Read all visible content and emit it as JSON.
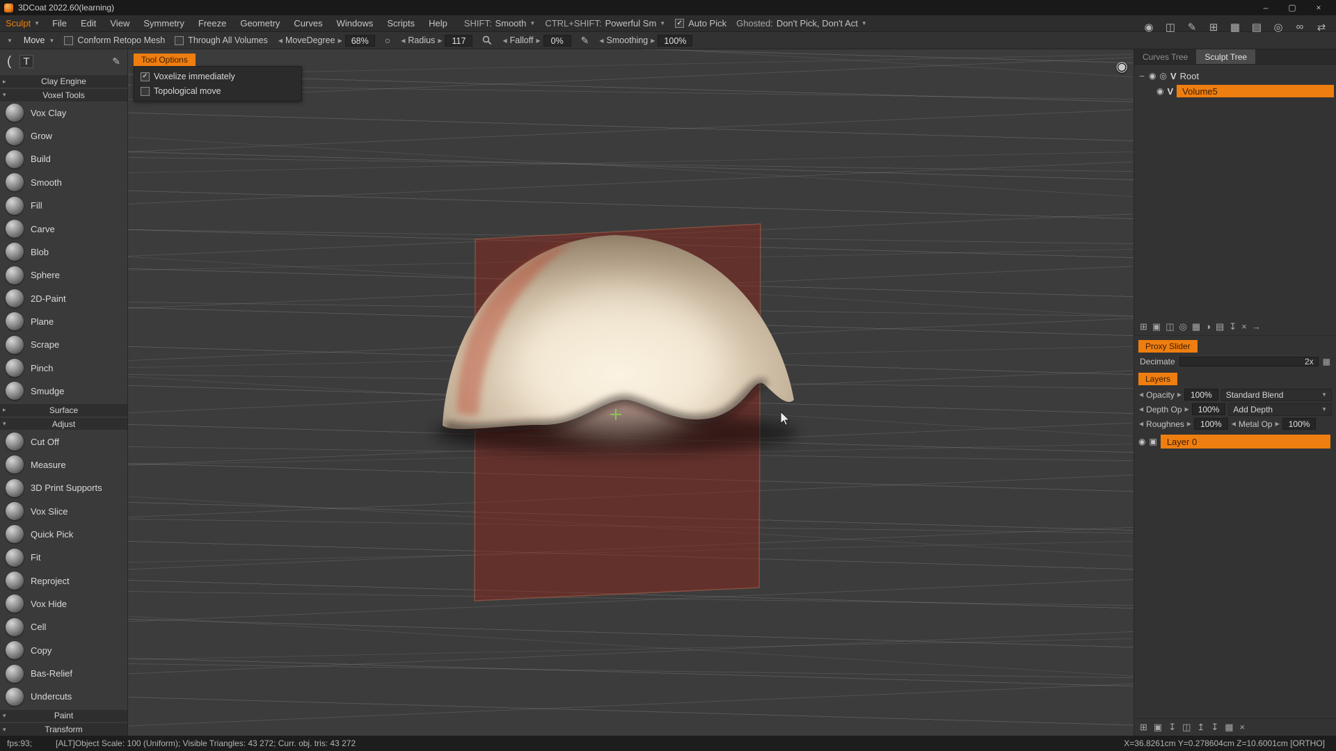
{
  "accent": "#ee7e10",
  "titlebar": {
    "title": "3DCoat 2022.60(learning)"
  },
  "menubar": {
    "room": "Sculpt",
    "items": [
      "File",
      "Edit",
      "View",
      "Symmetry",
      "Freeze",
      "Geometry",
      "Curves",
      "Windows",
      "Scripts",
      "Help"
    ],
    "shift_label": "SHIFT:",
    "shift_value": "Smooth",
    "ctrl_shift_label": "CTRL+SHIFT:",
    "ctrl_shift_value": "Powerful Sm",
    "auto_pick": {
      "label": "Auto Pick",
      "check": "✓"
    },
    "ghosted_label": "Ghosted:",
    "ghosted_value": "Don't Pick,  Don't Act"
  },
  "toolbar": {
    "tool": "Move",
    "conform": {
      "label": "Conform Retopo Mesh",
      "check": ""
    },
    "through": {
      "label": "Through All Volumes",
      "check": ""
    },
    "move_degree": {
      "label": "MoveDegree",
      "value": "68%"
    },
    "radius": {
      "label": "Radius",
      "value": "117"
    },
    "falloff": {
      "label": "Falloff",
      "value": "0%"
    },
    "smoothing": {
      "label": "Smoothing",
      "value": "100%"
    }
  },
  "tool_options": {
    "title": "Tool Options",
    "options": [
      {
        "label": "Voxelize immediately",
        "check": "✓"
      },
      {
        "label": "Topological move",
        "check": ""
      }
    ]
  },
  "left_panel": {
    "groups": [
      {
        "header": "Clay Engine",
        "arrow": "▸"
      },
      {
        "header": "Voxel Tools",
        "arrow": "▾"
      },
      {
        "header": "Surface",
        "arrow": "▸"
      },
      {
        "header": "Adjust",
        "arrow": "▾"
      },
      {
        "header": "Paint",
        "arrow": "▾"
      },
      {
        "header": "Transform",
        "arrow": "▾"
      }
    ],
    "voxel_tools": [
      "Vox Clay",
      "Grow",
      "Build",
      "Smooth",
      "Fill",
      "Carve",
      "Blob",
      "Sphere",
      "2D-Paint",
      "Plane",
      "Scrape",
      "Pinch",
      "Smudge"
    ],
    "adjust_tools": [
      "Cut Off",
      "Measure",
      "3D Print Supports",
      "Vox Slice",
      "Quick Pick",
      "Fit",
      "Reproject",
      "Vox Hide",
      "Cell",
      "Copy",
      "Bas-Relief",
      "Undercuts"
    ]
  },
  "right_panel": {
    "tabs": [
      "Curves Tree",
      "Sculpt Tree"
    ],
    "tree": {
      "root": "Root",
      "root_tag": "V",
      "volume": "Volume5",
      "volume_tag": "V"
    },
    "proxy": {
      "title": "Proxy Slider",
      "decimate_label": "Decimate",
      "decimate_value": "2x"
    },
    "layers": {
      "title": "Layers",
      "opacity_label": "Opacity",
      "opacity_value": "100%",
      "blend": "Standard Blend",
      "depth_label": "Depth Op",
      "depth_value": "100%",
      "depth_mode": "Add Depth",
      "roughness_label": "Roughnes",
      "roughness_value": "100%",
      "metal_label": "Metal Op",
      "metal_value": "100%",
      "layer_name": "Layer 0"
    }
  },
  "statusbar": {
    "fps": "fps:93;",
    "info": "[ALT]Object Scale: 100 (Uniform); Visible Triangles: 43 272; Curr. obj. tris: 43 272",
    "coords": "X=36.8261cm Y=0.278604cm Z=10.6001cm [ORTHO]"
  }
}
